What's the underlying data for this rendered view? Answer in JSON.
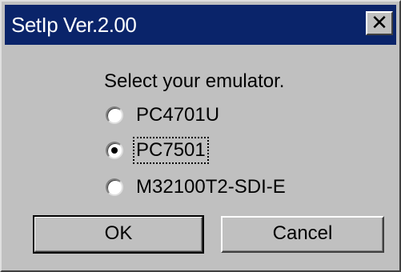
{
  "window": {
    "title": "SetIp Ver.2.00",
    "close_glyph": "✕"
  },
  "prompt": "Select your emulator.",
  "options": [
    {
      "label": "PC4701U",
      "checked": false
    },
    {
      "label": "PC7501",
      "checked": true
    },
    {
      "label": "M32100T2-SDI-E",
      "checked": false
    }
  ],
  "buttons": {
    "ok": "OK",
    "cancel": "Cancel"
  },
  "colors": {
    "titlebar": "#0a246a",
    "face": "#c0c0c0"
  }
}
